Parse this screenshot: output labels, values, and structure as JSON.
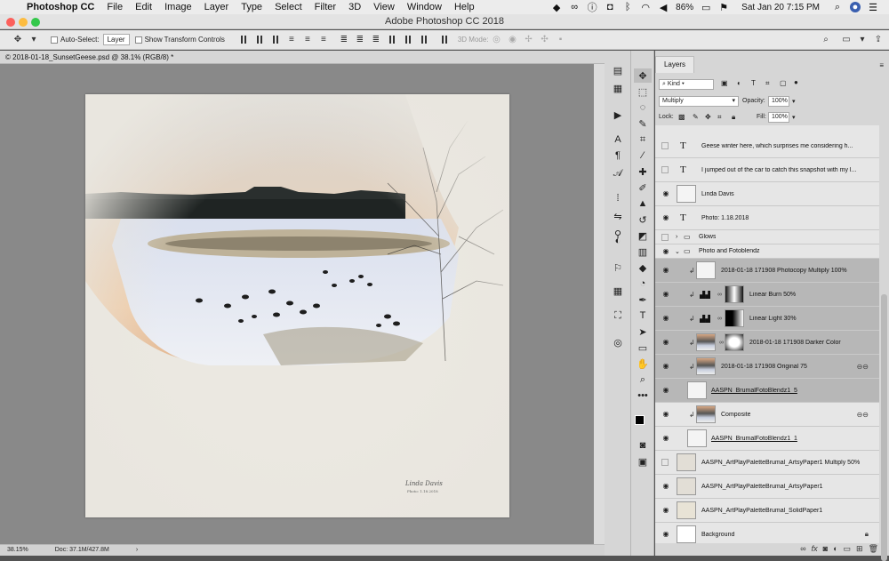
{
  "menubar": {
    "app": "Photoshop CC",
    "items": [
      "File",
      "Edit",
      "Image",
      "Layer",
      "Type",
      "Select",
      "Filter",
      "3D",
      "View",
      "Window",
      "Help"
    ],
    "battery": "86%",
    "clock": "Sat Jan 20  7:15 PM"
  },
  "window": {
    "title": "Adobe Photoshop CC 2018"
  },
  "options": {
    "auto_select": "Auto-Select:",
    "layer_select": "Layer",
    "transform": "Show Transform Controls",
    "mode3d": "3D Mode:"
  },
  "document": {
    "tab": "© 2018-01-18_SunsetGeese.psd @ 38.1% (RGB/8) *",
    "signature": "Linda Davis",
    "photo_date": "Photo: 1.18.2018"
  },
  "status": {
    "zoom": "38.15%",
    "doc": "Doc: 37.1M/427.8M"
  },
  "panel": {
    "tab": "Layers",
    "kind": "Kind",
    "blend": "Multiply",
    "opacity_label": "Opacity:",
    "opacity": "100%",
    "lock_label": "Lock:",
    "fill_label": "Fill:",
    "fill": "100%"
  },
  "layers": [
    {
      "name": "Geese winter here,     which surprises me considering h...",
      "type": "text",
      "visible": false,
      "selected": false
    },
    {
      "name": "I jumped out of the car to catch this snapshot with my l...",
      "type": "text",
      "visible": false,
      "selected": false
    },
    {
      "name": "Linda Davis",
      "type": "image",
      "visible": true,
      "selected": false
    },
    {
      "name": "Photo: 1.18.2018",
      "type": "text",
      "visible": true,
      "selected": false
    },
    {
      "name": "Glows",
      "type": "group",
      "visible": false,
      "selected": false,
      "expanded": false
    },
    {
      "name": "Photo and Fotoblendz",
      "type": "group",
      "visible": true,
      "selected": false,
      "expanded": true
    },
    {
      "name": "2018-01-18 171908 Photocopy Multiply 100%",
      "type": "image",
      "visible": true,
      "selected": true,
      "clip": true
    },
    {
      "name": "Linear Burn 50%",
      "type": "adjust",
      "visible": true,
      "selected": true,
      "clip": true
    },
    {
      "name": "Linear Light 30%",
      "type": "adjust",
      "visible": true,
      "selected": true,
      "clip": true
    },
    {
      "name": "2018-01-18 171908 Darker Color",
      "type": "photo",
      "visible": true,
      "selected": true,
      "clip": true
    },
    {
      "name": "2018-01-18 171908 Original 75",
      "type": "photo",
      "visible": true,
      "selected": true,
      "clip": true
    },
    {
      "name": "AASPN_BrumalFotoBlendz1_5",
      "type": "image",
      "visible": true,
      "selected": true,
      "underline": true
    },
    {
      "name": "Composite",
      "type": "photo",
      "visible": true,
      "selected": false,
      "clip": true
    },
    {
      "name": "AASPN_BrumalFotoBlendz1_1",
      "type": "image",
      "visible": true,
      "selected": false,
      "underline": true
    },
    {
      "name": "AASPN_ArtPlayPaletteBrumal_ArtsyPaper1 Multiply 50%",
      "type": "paper",
      "visible": false,
      "selected": false
    },
    {
      "name": "AASPN_ArtPlayPaletteBrumal_ArtsyPaper1",
      "type": "paper",
      "visible": true,
      "selected": false
    },
    {
      "name": "AASPN_ArtPlayPaletteBrumal_SolidPaper1",
      "type": "paper",
      "visible": true,
      "selected": false
    },
    {
      "name": "Background",
      "type": "bg",
      "visible": true,
      "selected": false
    }
  ]
}
